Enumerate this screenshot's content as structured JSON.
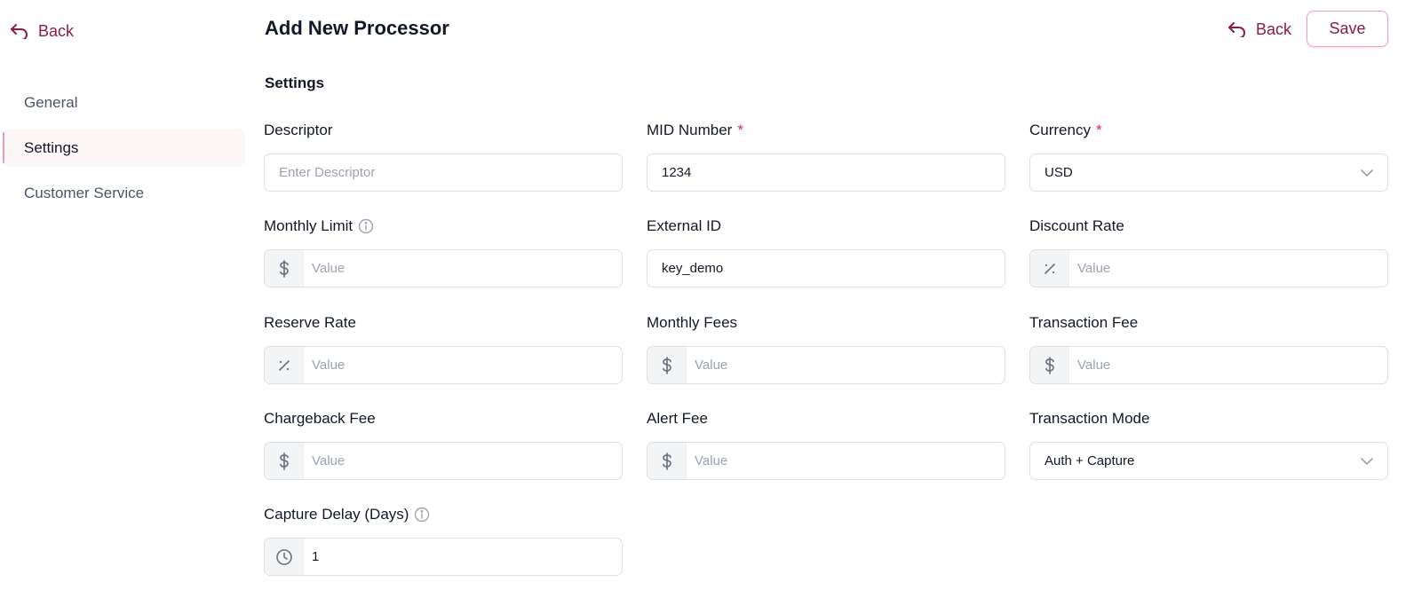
{
  "nav": {
    "back_label": "Back",
    "items": [
      {
        "label": "General"
      },
      {
        "label": "Settings"
      },
      {
        "label": "Customer Service"
      }
    ]
  },
  "header": {
    "title": "Add New Processor",
    "back_label": "Back",
    "save_label": "Save"
  },
  "section": {
    "title": "Settings"
  },
  "fields": {
    "descriptor": {
      "label": "Descriptor",
      "placeholder": "Enter Descriptor",
      "value": ""
    },
    "mid_number": {
      "label": "MID Number",
      "required_mark": "*",
      "value": "1234"
    },
    "currency": {
      "label": "Currency",
      "required_mark": "*",
      "selected": "USD"
    },
    "monthly_limit": {
      "label": "Monthly Limit",
      "addon_icon": "dollar-icon",
      "placeholder": "Value",
      "value": ""
    },
    "external_id": {
      "label": "External ID",
      "value": "key_demo"
    },
    "discount_rate": {
      "label": "Discount Rate",
      "addon_icon": "percent-icon",
      "placeholder": "Value",
      "value": ""
    },
    "reserve_rate": {
      "label": "Reserve Rate",
      "addon_icon": "percent-icon",
      "placeholder": "Value",
      "value": ""
    },
    "monthly_fees": {
      "label": "Monthly Fees",
      "addon_icon": "dollar-icon",
      "placeholder": "Value",
      "value": ""
    },
    "transaction_fee": {
      "label": "Transaction Fee",
      "addon_icon": "dollar-icon",
      "placeholder": "Value",
      "value": ""
    },
    "chargeback_fee": {
      "label": "Chargeback Fee",
      "addon_icon": "dollar-icon",
      "placeholder": "Value",
      "value": ""
    },
    "alert_fee": {
      "label": "Alert Fee",
      "addon_icon": "dollar-icon",
      "placeholder": "Value",
      "value": ""
    },
    "transaction_mode": {
      "label": "Transaction Mode",
      "selected": "Auth + Capture"
    },
    "capture_delay": {
      "label": "Capture Delay (Days)",
      "addon_icon": "clock-icon",
      "value": "1"
    }
  },
  "colors": {
    "accent": "#8b1e3f",
    "accent_border": "#e9a3b6",
    "required": "#e11d48",
    "active_nav_bg": "#fef7f8"
  }
}
